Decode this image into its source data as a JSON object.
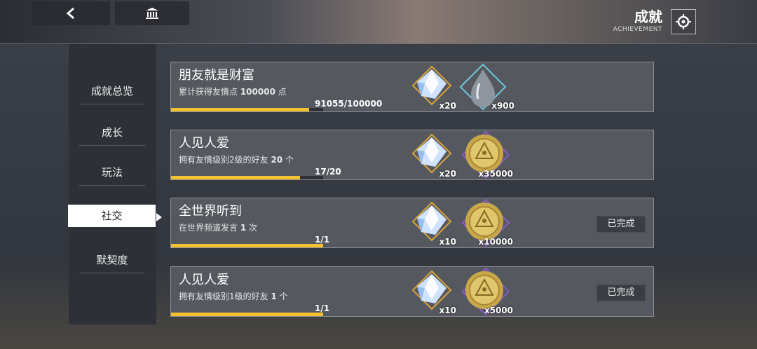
{
  "header": {
    "title": "成就",
    "subtitle": "ACHIEVEMENT"
  },
  "sidebar": {
    "items": [
      {
        "label": "成就总览"
      },
      {
        "label": "成长"
      },
      {
        "label": "玩法"
      },
      {
        "label": "社交"
      },
      {
        "label": "默契度"
      }
    ],
    "active": "社交"
  },
  "achievements": [
    {
      "title": "朋友就是财富",
      "desc_prefix": "累计获得友情点 ",
      "desc_value": "100000",
      "desc_suffix": " 点",
      "progress_text": "91055/100000",
      "progress": 0.91,
      "rewards": [
        {
          "item": "crystal-icon",
          "count": "x20"
        },
        {
          "item": "drop-icon",
          "count": "x900"
        }
      ],
      "status": ""
    },
    {
      "title": "人见人爱",
      "desc_prefix": "拥有友情级别2级的好友 ",
      "desc_value": "20",
      "desc_suffix": " 个",
      "progress_text": "17/20",
      "progress": 0.85,
      "rewards": [
        {
          "item": "crystal-icon",
          "count": "x20"
        },
        {
          "item": "coin-icon",
          "count": "x35000"
        }
      ],
      "status": ""
    },
    {
      "title": "全世界听到",
      "desc_prefix": "在世界频道发言 ",
      "desc_value": "1",
      "desc_suffix": " 次",
      "progress_text": "1/1",
      "progress": 1.0,
      "rewards": [
        {
          "item": "crystal-icon",
          "count": "x10"
        },
        {
          "item": "coin-icon",
          "count": "x10000"
        }
      ],
      "status": "已完成"
    },
    {
      "title": "人见人爱",
      "desc_prefix": "拥有友情级别1级的好友 ",
      "desc_value": "1",
      "desc_suffix": " 个",
      "progress_text": "1/1",
      "progress": 1.0,
      "rewards": [
        {
          "item": "crystal-icon",
          "count": "x10"
        },
        {
          "item": "coin-icon",
          "count": "x5000"
        }
      ],
      "status": "已完成"
    }
  ],
  "colors": {
    "progress": "#f2c230",
    "card_bg": "#55585f",
    "sidebar_bg": "#2d3037"
  }
}
